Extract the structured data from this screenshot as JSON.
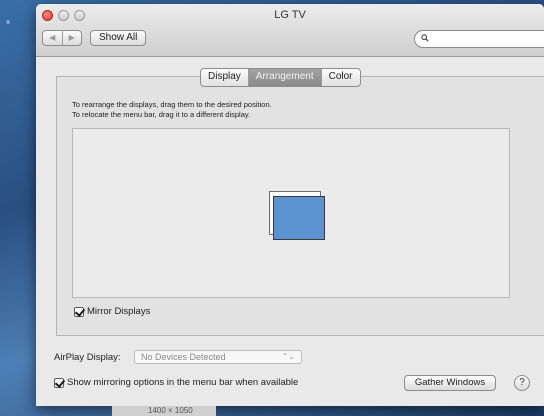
{
  "window": {
    "title": "LG TV"
  },
  "toolbar": {
    "back_glyph": "◀",
    "forward_glyph": "▶",
    "show_all_label": "Show All",
    "search_value": ""
  },
  "tabs": [
    {
      "label": "Display",
      "active": false
    },
    {
      "label": "Arrangement",
      "active": true
    },
    {
      "label": "Color",
      "active": false
    }
  ],
  "instructions": {
    "line1": "To rearrange the displays, drag them to the desired position.",
    "line2": "To relocate the menu bar, drag it to a different display."
  },
  "mirror_displays": {
    "label": "Mirror Displays",
    "checked": true
  },
  "airplay": {
    "label": "AirPlay Display:",
    "selected": "No Devices Detected",
    "arrow": "⌃⌄"
  },
  "show_mirroring": {
    "label": "Show mirroring options in the menu bar when available",
    "checked": true
  },
  "gather_windows_label": "Gather Windows",
  "help_label": "?",
  "behind_window_text": "1400 × 1050",
  "colors": {
    "display_blue": "#5b93d0",
    "active_tab": "#8f8f8f"
  }
}
